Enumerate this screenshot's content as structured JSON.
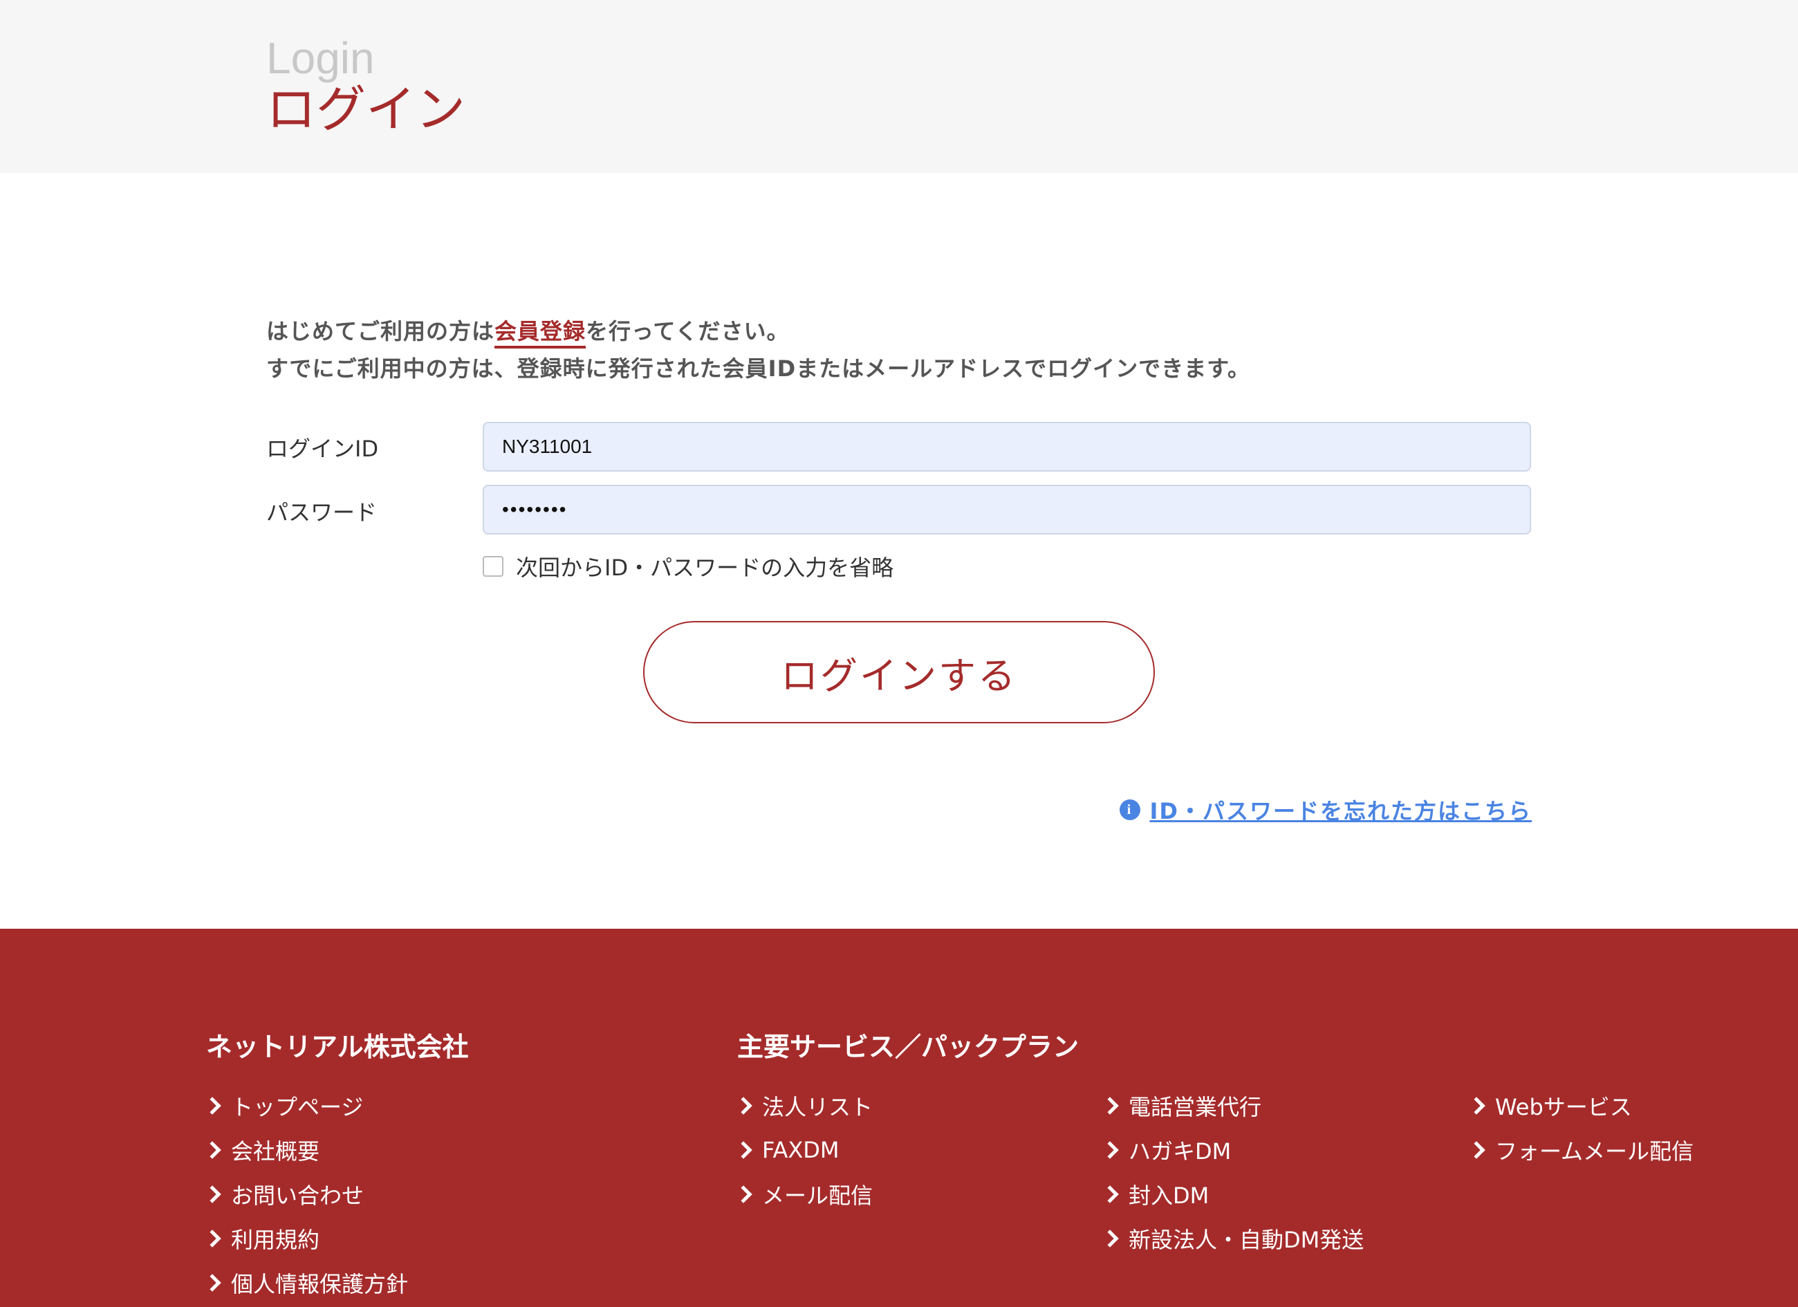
{
  "header": {
    "title_en": "Login",
    "title_jp": "ログイン"
  },
  "intro": {
    "line1_before": "はじめてご利用の方は",
    "line1_link": "会員登録",
    "line1_after": "を行ってください。",
    "line2": "すでにご利用中の方は、登録時に発行された会員IDまたはメールアドレスでログインできます。"
  },
  "form": {
    "id_label": "ログインID",
    "id_value": "NY311001",
    "password_label": "パスワード",
    "password_value": "••••••••",
    "remember_label": "次回からID・パスワードの入力を省略",
    "remember_checked": false,
    "submit_label": "ログインする",
    "forgot_link": "ID・パスワードを忘れた方はこちら",
    "forgot_icon": "info-icon"
  },
  "footer": {
    "company_heading": "ネットリアル株式会社",
    "company_links": [
      "トップページ",
      "会社概要",
      "お問い合わせ",
      "利用規約",
      "個人情報保護方針"
    ],
    "services_heading": "主要サービス／パックプラン",
    "services_col1": [
      "法人リスト",
      "FAXDM",
      "メール配信"
    ],
    "services_col2": [
      "電話営業代行",
      "ハガキDM",
      "封入DM",
      "新設法人・自動DM発送"
    ],
    "services_col3": [
      "Webサービス",
      "フォームメール配信"
    ]
  },
  "colors": {
    "brand_red": "#a52b2b",
    "link_blue": "#4a84e3",
    "input_bg": "#e9effd",
    "header_bg": "#f6f6f6"
  }
}
